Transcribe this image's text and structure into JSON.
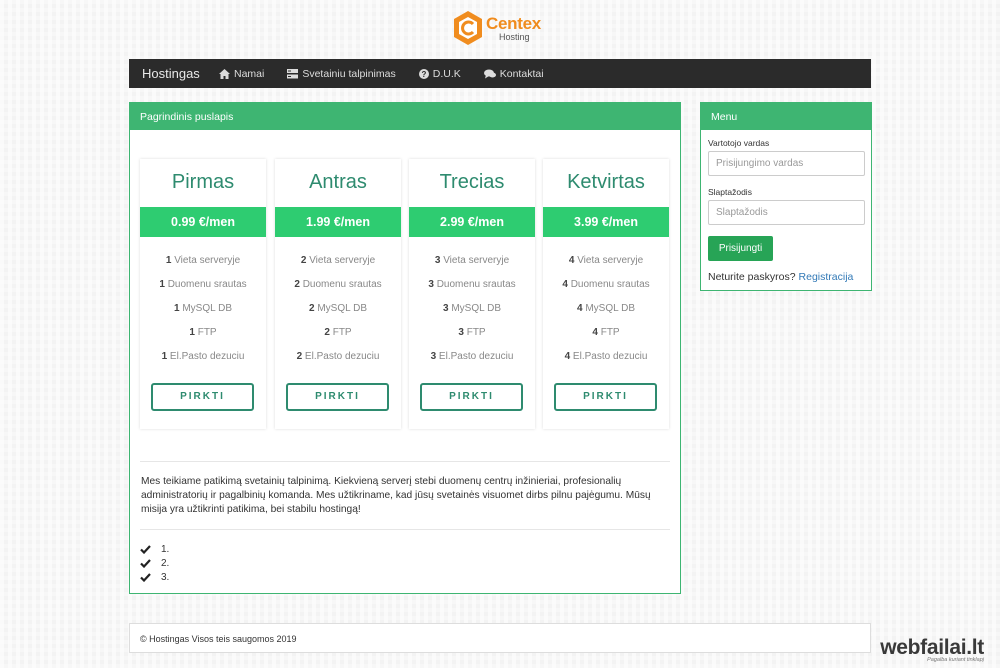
{
  "logo": {
    "word": "Centex",
    "sub": "Hosting",
    "icon": "hexagon-c-logo",
    "color": "#f08c1e"
  },
  "navbar": {
    "brand": "Hostingas",
    "items": [
      {
        "label": "Namai",
        "icon": "home-icon"
      },
      {
        "label": "Svetainiu talpinimas",
        "icon": "server-icon"
      },
      {
        "label": "D.U.K",
        "icon": "question-icon"
      },
      {
        "label": "Kontaktai",
        "icon": "comments-icon"
      }
    ]
  },
  "main": {
    "heading": "Pagrindinis puslapis",
    "plans": [
      {
        "name": "Pirmas",
        "price": "0.99 €/men",
        "qty": "1",
        "buy": "PIRKTI"
      },
      {
        "name": "Antras",
        "price": "1.99 €/men",
        "qty": "2",
        "buy": "PIRKTI"
      },
      {
        "name": "Trecias",
        "price": "2.99 €/men",
        "qty": "3",
        "buy": "PIRKTI"
      },
      {
        "name": "Ketvirtas",
        "price": "3.99 €/men",
        "qty": "4",
        "buy": "PIRKTI"
      }
    ],
    "features": [
      "Vieta serveryje",
      "Duomenu srautas",
      "MySQL DB",
      "FTP",
      "El.Pasto dezuciu"
    ],
    "about": "Mes teikiame patikimą svetainių talpinimą. Kiekvieną serverį stebi duomenų centrų inžinieriai, profesionalių administratorių ir pagalbinių komanda. Mes užtikriname, kad jūsų svetainės visuomet dirbs pilnu pajėgumu. Mūsų misija yra užtikrinti patikima, bei stabilu hostingą!",
    "checklist": [
      "1.",
      "2.",
      "3."
    ]
  },
  "menu": {
    "heading": "Menu",
    "username_label": "Vartotojo vardas",
    "username_placeholder": "Prisijungimo vardas",
    "password_label": "Slaptažodis",
    "password_placeholder": "Slaptažodis",
    "login": "Prisijungti",
    "no_account": "Neturite paskyros?",
    "register": "Registracija"
  },
  "footer": {
    "text": "© Hostingas Visos teis saugomos 2019"
  },
  "watermark": {
    "main": "webfailai.lt",
    "sub": "Pagalba kuriant tinklapį"
  },
  "colors": {
    "accent": "#3eb572",
    "price_bar": "#2ecc71",
    "nav_bg": "#2b2b2b",
    "link": "#337ab7"
  }
}
